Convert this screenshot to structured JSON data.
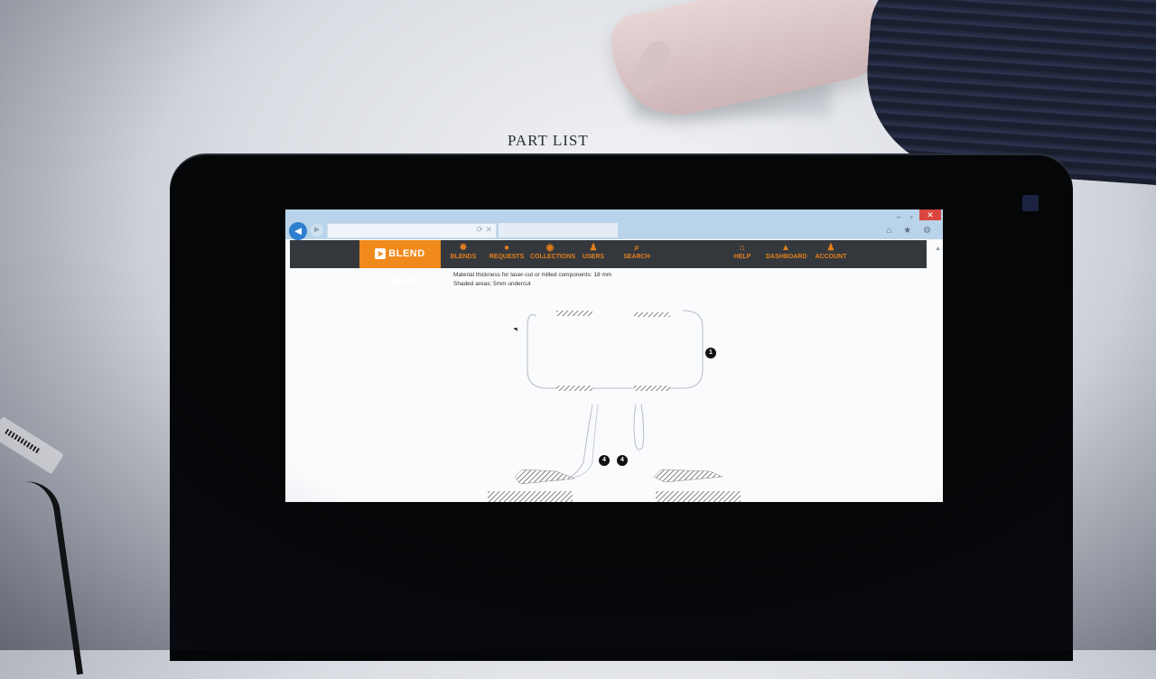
{
  "wall_label": "PART LIST",
  "browser": {
    "back_icon": "back-arrow-icon",
    "forward_icon": "forward-arrow-icon",
    "address_icons": "⟳ ✕",
    "window_min": "‒",
    "window_max": "▫",
    "window_close": "✕",
    "toolbar_icons": "⌂ ★ ⚙"
  },
  "site": {
    "logo": "BLEND SWAP",
    "logo_color": "#f08a1c",
    "nav_left": [
      {
        "label": "BLENDS",
        "icon": "✹"
      },
      {
        "label": "REQUESTS",
        "icon": "●"
      },
      {
        "label": "COLLECTIONS",
        "icon": "◉"
      },
      {
        "label": "USERS",
        "icon": "♟"
      },
      {
        "label": "SEARCH",
        "icon": "⌕"
      }
    ],
    "nav_right": [
      {
        "label": "HELP",
        "icon": "⌂"
      },
      {
        "label": "DASHBOARD",
        "icon": "▲"
      },
      {
        "label": "ACCOUNT",
        "icon": "♟"
      }
    ]
  },
  "content": {
    "line1": "Material thickness for laser-cut or milled components: 18 mm",
    "line2": "Shaded areas: 5mm undercut"
  },
  "callouts": [
    "1",
    "4",
    "4"
  ]
}
